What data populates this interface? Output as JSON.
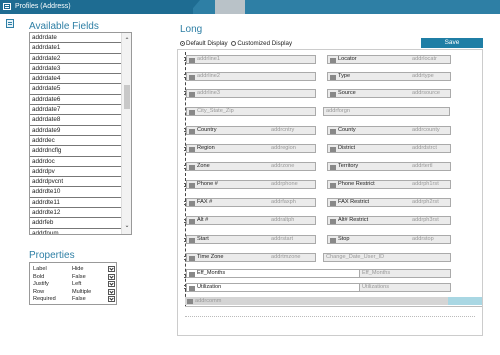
{
  "window": {
    "title": "Profiles (Address)"
  },
  "available_fields": {
    "title": "Available Fields",
    "items": [
      "addrdate",
      "addrdate1",
      "addrdate2",
      "addrdate3",
      "addrdate4",
      "addrdate5",
      "addrdate6",
      "addrdate7",
      "addrdate8",
      "addrdate9",
      "addrdec",
      "addrdncflg",
      "addrdoc",
      "addrdpv",
      "addrdpvcnt",
      "addrdte10",
      "addrdte11",
      "addrdte12",
      "addrfeb",
      "addrfnum"
    ]
  },
  "properties": {
    "title": "Properties",
    "rows": [
      {
        "label": "Label",
        "value": "Hide"
      },
      {
        "label": "Bold",
        "value": "False"
      },
      {
        "label": "Justify",
        "value": "Left"
      },
      {
        "label": "Row",
        "value": "Multiple"
      },
      {
        "label": "Required",
        "value": "False"
      }
    ]
  },
  "layout": {
    "title": "Long",
    "default_display": "Default Display",
    "customized_display": "Customized Display",
    "save_label": "Save"
  },
  "fields": {
    "f1": {
      "name": "addrline1"
    },
    "f2": {
      "label": "Locator",
      "name": "addrlocatr"
    },
    "f3": {
      "name": "addrline2"
    },
    "f4": {
      "label": "Type",
      "name": "addrtype"
    },
    "f5": {
      "name": "addrline3"
    },
    "f6": {
      "label": "Source",
      "name": "addrsource"
    },
    "f7": {
      "label": "City_State_Zip"
    },
    "f8": {
      "name": "addrforgn"
    },
    "f9": {
      "label": "Country",
      "name": "addrcntry"
    },
    "f10": {
      "label": "County",
      "name": "addrcounty"
    },
    "f11": {
      "label": "Region",
      "name": "addregion"
    },
    "f12": {
      "label": "District",
      "name": "addrdstrct"
    },
    "f13": {
      "label": "Zone",
      "name": "addrzone"
    },
    "f14": {
      "label": "Territory",
      "name": "addrtertl"
    },
    "f15": {
      "label": "Phone #",
      "name": "addrphone"
    },
    "f16": {
      "label": "Phone Restrict",
      "name": "addrph1rst"
    },
    "f17": {
      "label": "FAX #",
      "name": "addrfaxph"
    },
    "f18": {
      "label": "FAX Restrict",
      "name": "addrph2rst"
    },
    "f19": {
      "label": "Alt #",
      "name": "addraltph"
    },
    "f20": {
      "label": "Alt# Restrict",
      "name": "addrph3rst"
    },
    "f21": {
      "label": "Start",
      "name": "addrstart"
    },
    "f22": {
      "label": "Stop",
      "name": "addrstop"
    },
    "f23": {
      "label": "Time Zone",
      "name": "addrtmzone"
    },
    "f24": {
      "label": "Change_Date_User_ID"
    },
    "f25": {
      "label": "Eff_Months",
      "name": "Eff_Months"
    },
    "f26": {
      "label": "Utilization",
      "name": "Utilizations"
    },
    "f27": {
      "name": "addrcomm"
    }
  }
}
